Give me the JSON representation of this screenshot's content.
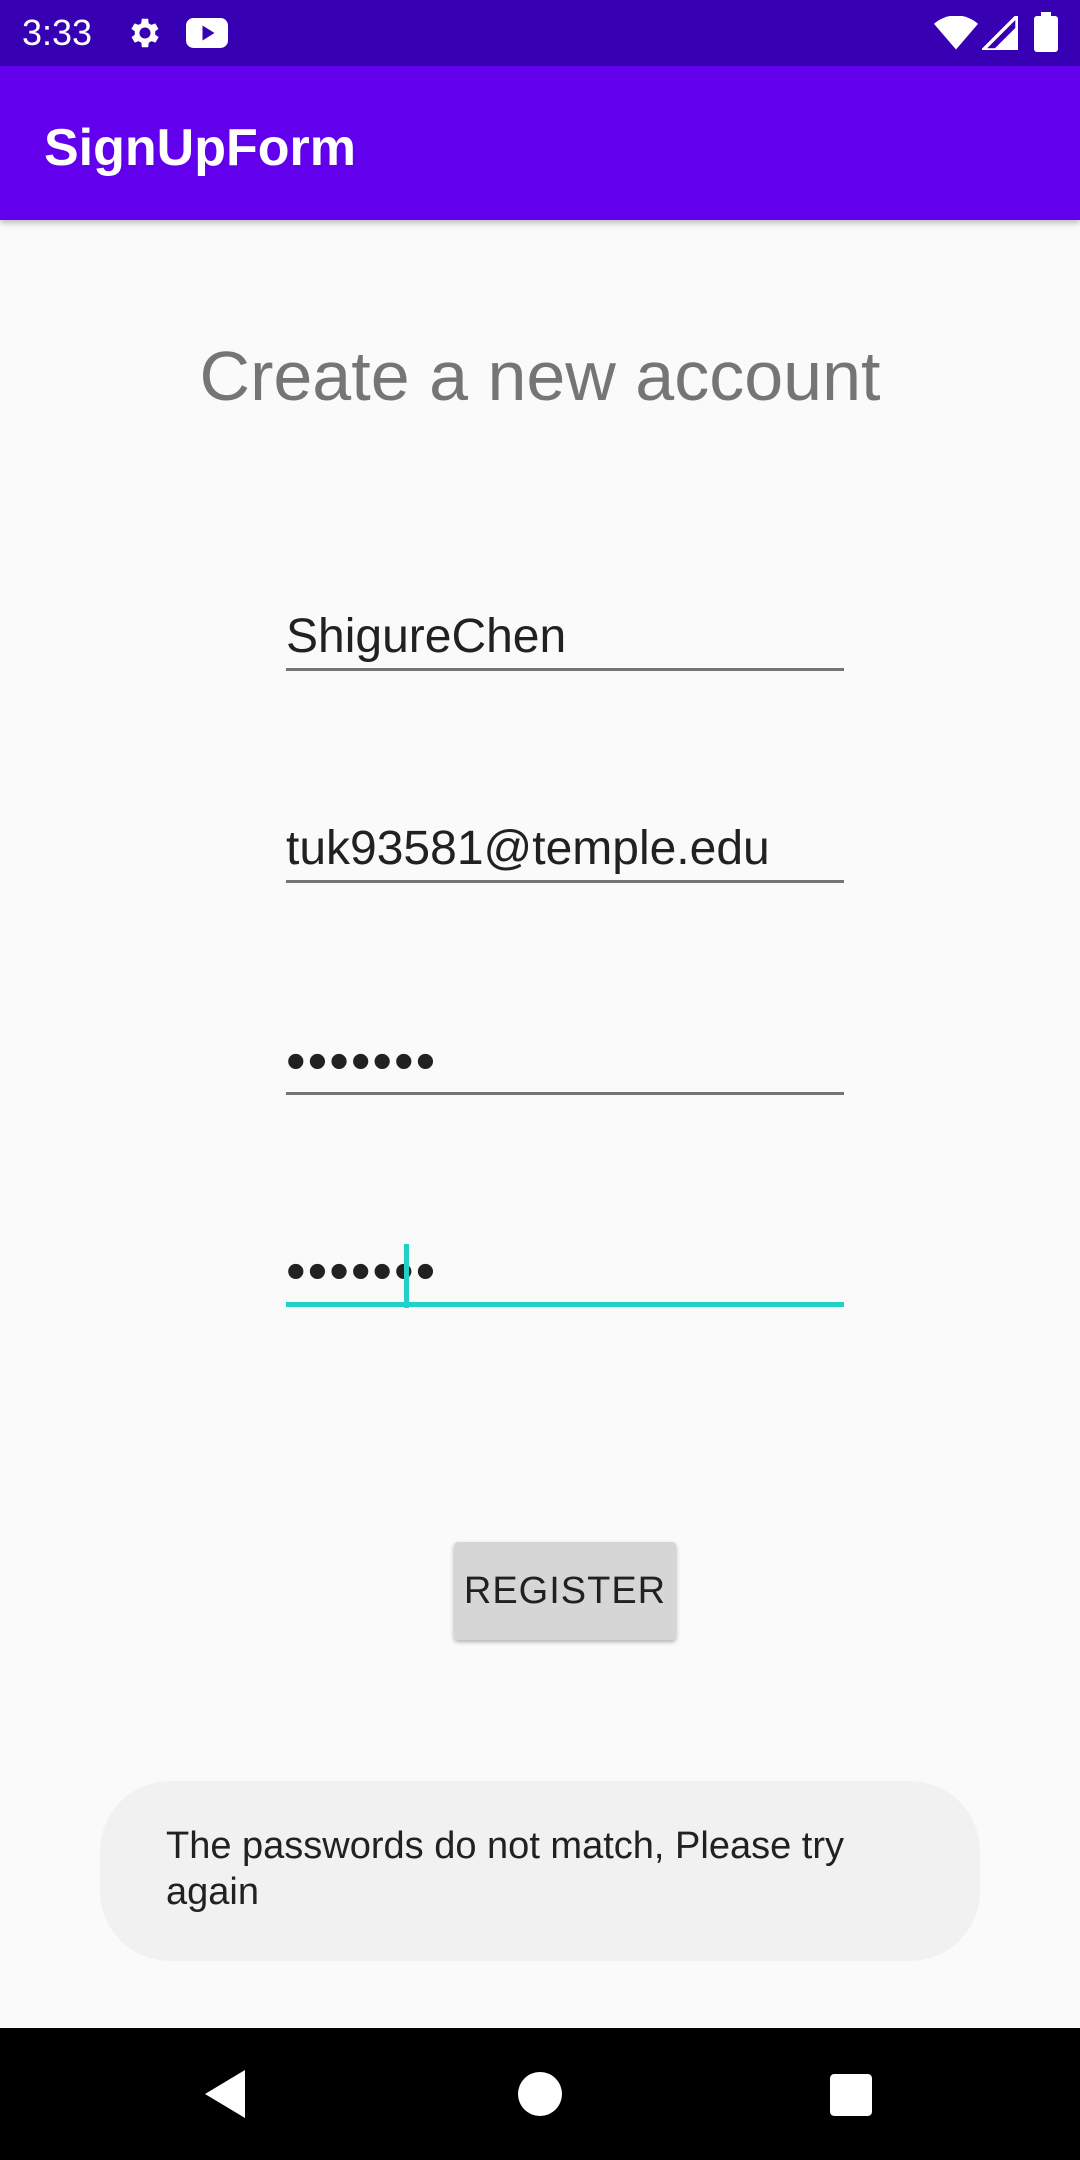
{
  "status_bar": {
    "time": "3:33",
    "icons": [
      "gear-icon",
      "youtube-icon",
      "wifi-icon",
      "cell-signal-icon",
      "battery-icon"
    ]
  },
  "app_bar": {
    "title": "SignUpForm",
    "color": "#6200ee"
  },
  "form": {
    "heading": "Create a new account",
    "name_value": "ShigureChen",
    "email_value": "tuk93581@temple.edu",
    "password_value": "•••••••",
    "confirm_password_value": "•••••••",
    "register_label": "REGISTER"
  },
  "toast": {
    "message": "The passwords do not match, Please try again"
  },
  "nav_bar": {
    "icons": [
      "back-icon",
      "home-icon",
      "recents-icon"
    ]
  },
  "colors": {
    "status_bar": "#3700b3",
    "accent": "#1fd1c6"
  }
}
